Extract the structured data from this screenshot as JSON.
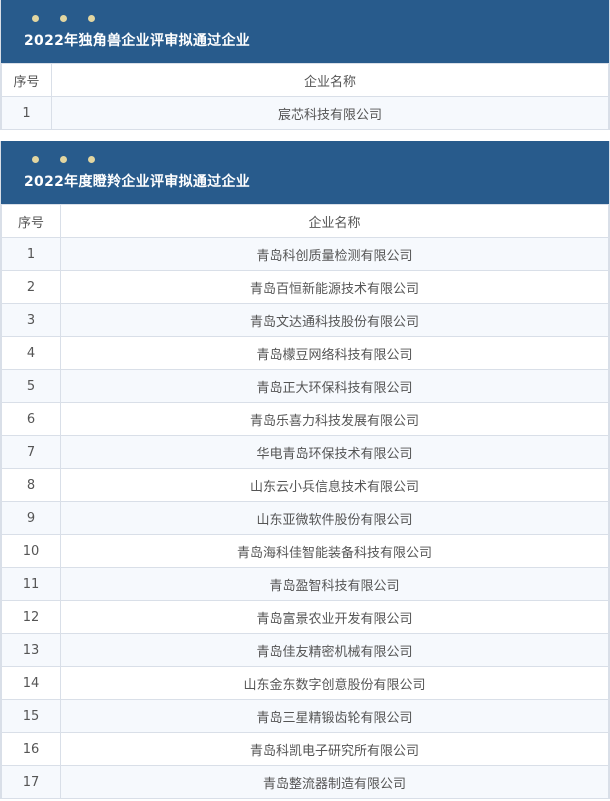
{
  "section1": {
    "title": "2022年独角兽企业评审拟通过企业",
    "headers": {
      "no": "序号",
      "name": "企业名称"
    },
    "rows": [
      {
        "no": "1",
        "name": "宸芯科技有限公司"
      }
    ]
  },
  "section2": {
    "title": "2022年度瞪羚企业评审拟通过企业",
    "headers": {
      "no": "序号",
      "name": "企业名称"
    },
    "rows": [
      {
        "no": "1",
        "name": "青岛科创质量检测有限公司"
      },
      {
        "no": "2",
        "name": "青岛百恒新能源技术有限公司"
      },
      {
        "no": "3",
        "name": "青岛文达通科技股份有限公司"
      },
      {
        "no": "4",
        "name": "青岛檬豆网络科技有限公司"
      },
      {
        "no": "5",
        "name": "青岛正大环保科技有限公司"
      },
      {
        "no": "6",
        "name": "青岛乐喜力科技发展有限公司"
      },
      {
        "no": "7",
        "name": "华电青岛环保技术有限公司"
      },
      {
        "no": "8",
        "name": "山东云小兵信息技术有限公司"
      },
      {
        "no": "9",
        "name": "山东亚微软件股份有限公司"
      },
      {
        "no": "10",
        "name": "青岛海科佳智能装备科技有限公司"
      },
      {
        "no": "11",
        "name": "青岛盈智科技有限公司"
      },
      {
        "no": "12",
        "name": "青岛富景农业开发有限公司"
      },
      {
        "no": "13",
        "name": "青岛佳友精密机械有限公司"
      },
      {
        "no": "14",
        "name": "山东金东数字创意股份有限公司"
      },
      {
        "no": "15",
        "name": "青岛三星精锻齿轮有限公司"
      },
      {
        "no": "16",
        "name": "青岛科凯电子研究所有限公司"
      },
      {
        "no": "17",
        "name": "青岛整流器制造有限公司"
      }
    ]
  },
  "colors": {
    "banner": "#285b8c",
    "dot": "#e2d6a1",
    "row_alt": "#f6f9fd",
    "border": "#d9dfe8"
  },
  "icons": {
    "banner_dots": "dot-icon"
  }
}
